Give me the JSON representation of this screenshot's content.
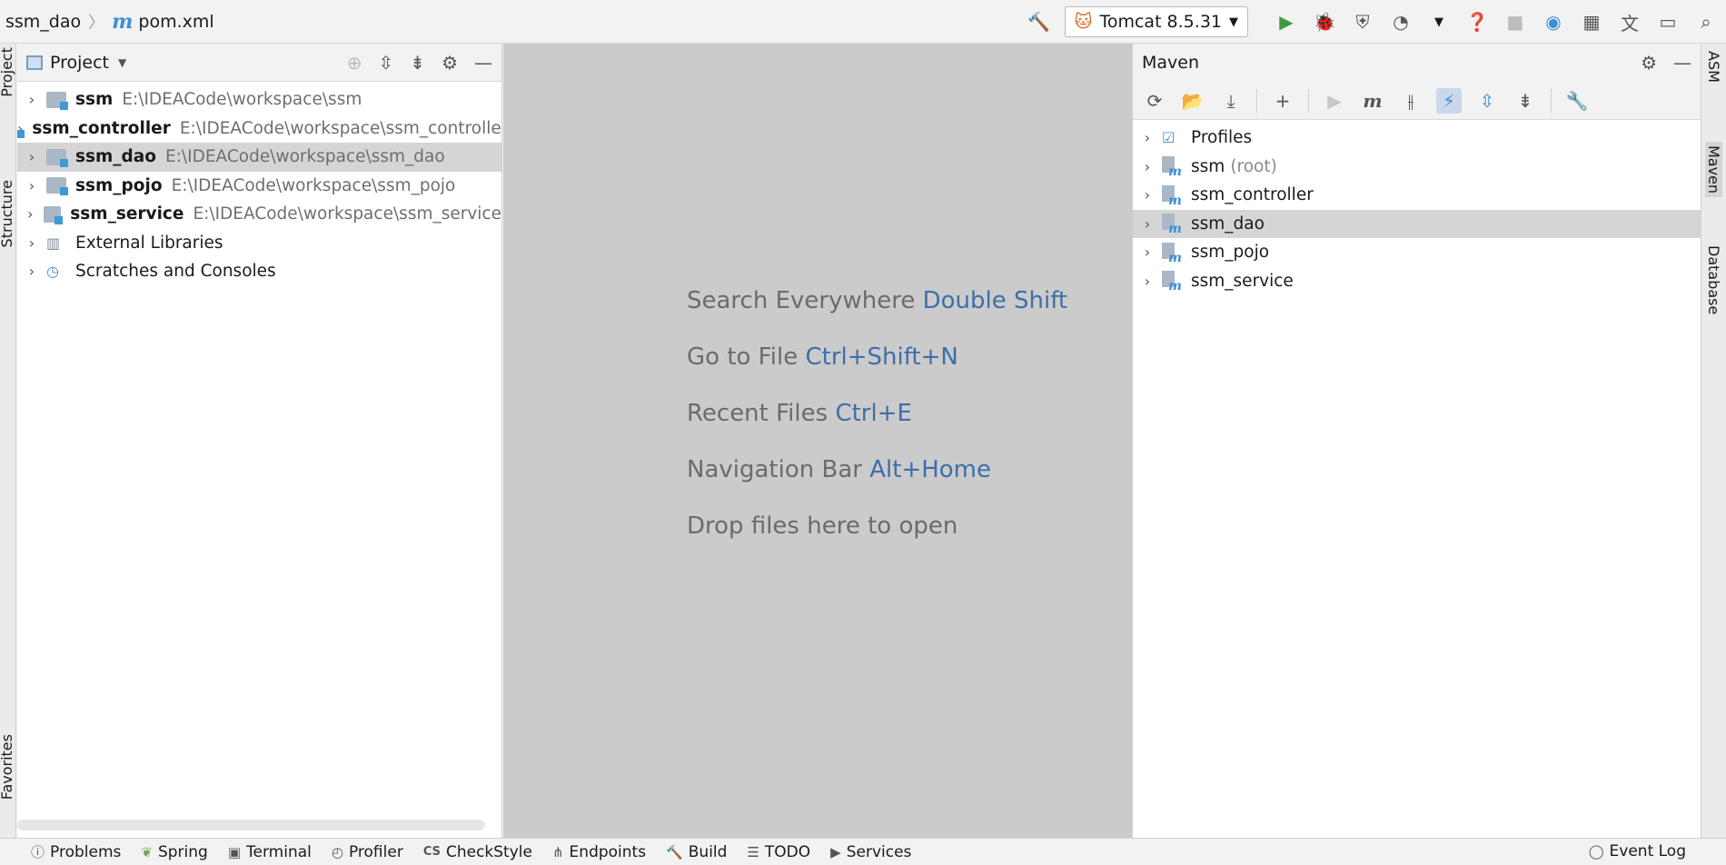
{
  "breadcrumb": {
    "project": "ssm_dao",
    "file": "pom.xml"
  },
  "run_config": {
    "label": "Tomcat 8.5.31"
  },
  "left_strip": {
    "project": "Project",
    "structure": "Structure",
    "favorites": "Favorites"
  },
  "right_strip": {
    "asm": "ASM",
    "maven": "Maven",
    "database": "Database"
  },
  "project_panel": {
    "title": "Project",
    "items": [
      {
        "name": "ssm",
        "path": "E:\\IDEACode\\workspace\\ssm"
      },
      {
        "name": "ssm_controller",
        "path": "E:\\IDEACode\\workspace\\ssm_controller"
      },
      {
        "name": "ssm_dao",
        "path": "E:\\IDEACode\\workspace\\ssm_dao"
      },
      {
        "name": "ssm_pojo",
        "path": "E:\\IDEACode\\workspace\\ssm_pojo"
      },
      {
        "name": "ssm_service",
        "path": "E:\\IDEACode\\workspace\\ssm_service"
      },
      {
        "name": "External Libraries"
      },
      {
        "name": "Scratches and Consoles"
      }
    ]
  },
  "editor_hints": [
    {
      "text": "Search Everywhere",
      "key": "Double Shift"
    },
    {
      "text": "Go to File",
      "key": "Ctrl+Shift+N"
    },
    {
      "text": "Recent Files",
      "key": "Ctrl+E"
    },
    {
      "text": "Navigation Bar",
      "key": "Alt+Home"
    },
    {
      "text": "Drop files here to open",
      "key": ""
    }
  ],
  "maven_panel": {
    "title": "Maven",
    "items": [
      {
        "name": "Profiles",
        "suffix": ""
      },
      {
        "name": "ssm",
        "suffix": "(root)"
      },
      {
        "name": "ssm_controller",
        "suffix": ""
      },
      {
        "name": "ssm_dao",
        "suffix": ""
      },
      {
        "name": "ssm_pojo",
        "suffix": ""
      },
      {
        "name": "ssm_service",
        "suffix": ""
      }
    ]
  },
  "statusbar": {
    "problems": "Problems",
    "spring": "Spring",
    "terminal": "Terminal",
    "profiler": "Profiler",
    "checkstyle": "CheckStyle",
    "endpoints": "Endpoints",
    "build": "Build",
    "todo": "TODO",
    "services": "Services",
    "event_log": "Event Log"
  }
}
